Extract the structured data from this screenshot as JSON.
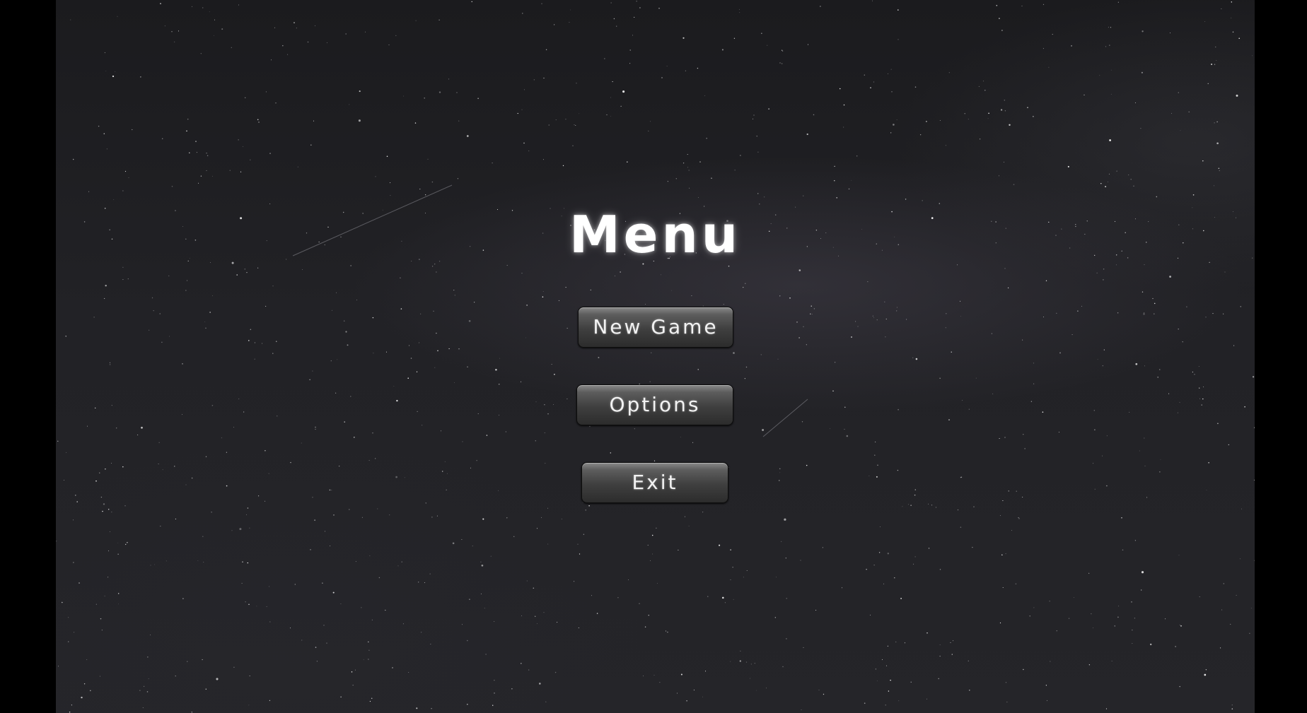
{
  "menu": {
    "title": "Menu",
    "buttons": {
      "new_game": "New Game",
      "options": "Options",
      "exit": "Exit"
    }
  },
  "colors": {
    "background": "#222226",
    "letterbox": "#000000",
    "title": "#ffffff",
    "button_top": "#8a8a8a",
    "button_bottom": "#2c2c2c",
    "button_text": "#f2f2f2"
  }
}
